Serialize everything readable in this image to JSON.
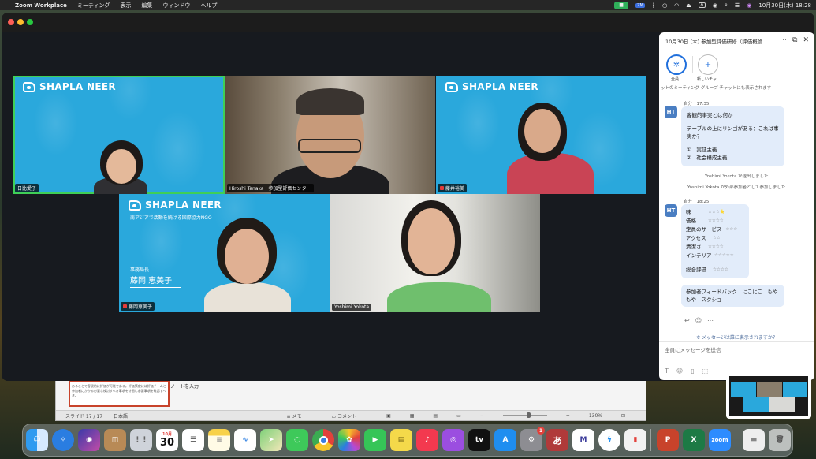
{
  "menubar": {
    "app": "Zoom Workplace",
    "menus": [
      "ミーティング",
      "表示",
      "編集",
      "ウィンドウ",
      "ヘルプ"
    ],
    "datetime": "10月30日(木) 18:28"
  },
  "powerpoint": {
    "thumb_text": "あることで客観的に評価が可能である。評価策定には評価チームと参加者にかかる必要な検討すべき事項を計画し必要事項を確認すべき。",
    "notes_placeholder": "ノートを入力",
    "slide_status": "スライド 17 / 17",
    "language": "日本語",
    "memo": "メモ",
    "comment": "コメント",
    "zoom": "130%"
  },
  "tiles": [
    {
      "name": "日比愛子",
      "muted": false,
      "logo": "SHAPLA NEER"
    },
    {
      "name": "Hiroshi Tanaka　参加型評価センター",
      "muted": false
    },
    {
      "name": "藤井裕美",
      "muted": true,
      "logo": "SHAPLA NEER"
    },
    {
      "name": "藤岡恵美子",
      "muted": true,
      "logo": "SHAPLA NEER",
      "subtitle": "南アジアで活動を続ける国際協力NGO",
      "role": "事務局長",
      "bigname": "藤岡 恵美子"
    },
    {
      "name": "Yoshimi Yokota",
      "muted": false
    }
  ],
  "chat": {
    "title": "10月30日 (木) 参加型評価研修（評価概論...",
    "tools": [
      {
        "label": "全員"
      },
      {
        "label": "新しいチャ..."
      }
    ],
    "top_note": "ットのミーティング グループ チャットにも表示されます",
    "messages": [
      {
        "avatar": "HT",
        "sender": "自分",
        "time": "17:35",
        "lines": [
          "客観的事実とは何か",
          "テーブルの上にリンゴがある：これは事実か？",
          "①　実証主義",
          "②　社会構成主義"
        ]
      },
      {
        "avatar": "HT",
        "sender": "自分",
        "time": "18:25",
        "ratings": [
          {
            "label": "味",
            "stars": "☆☆☆⭐"
          },
          {
            "label": "価格",
            "stars": "☆☆☆☆"
          },
          {
            "label": "定員のサービス",
            "stars": "☆☆☆"
          },
          {
            "label": "アクセス",
            "stars": "☆☆"
          },
          {
            "label": "清潔さ",
            "stars": "☆☆☆☆"
          },
          {
            "label": "インテリア",
            "stars": "☆☆☆☆☆"
          },
          {
            "label": "総合評価",
            "stars": "☆☆☆☆"
          }
        ],
        "followup": "参加者フィードバック　にこにこ　もやもや　スクショ"
      }
    ],
    "system": [
      "Yoshimi Yokota が退出しました",
      "Yoshimi Yokota が外部参加者として参加しました"
    ],
    "hint": "メッセージは誰に表示されますか？",
    "input_placeholder": "全員にメッセージを送信"
  },
  "dock": {
    "calendar_month": "10月",
    "calendar_day": "30",
    "settings_badge": "1",
    "ime": "あ",
    "tv": "tv",
    "zoom": "zoom"
  }
}
